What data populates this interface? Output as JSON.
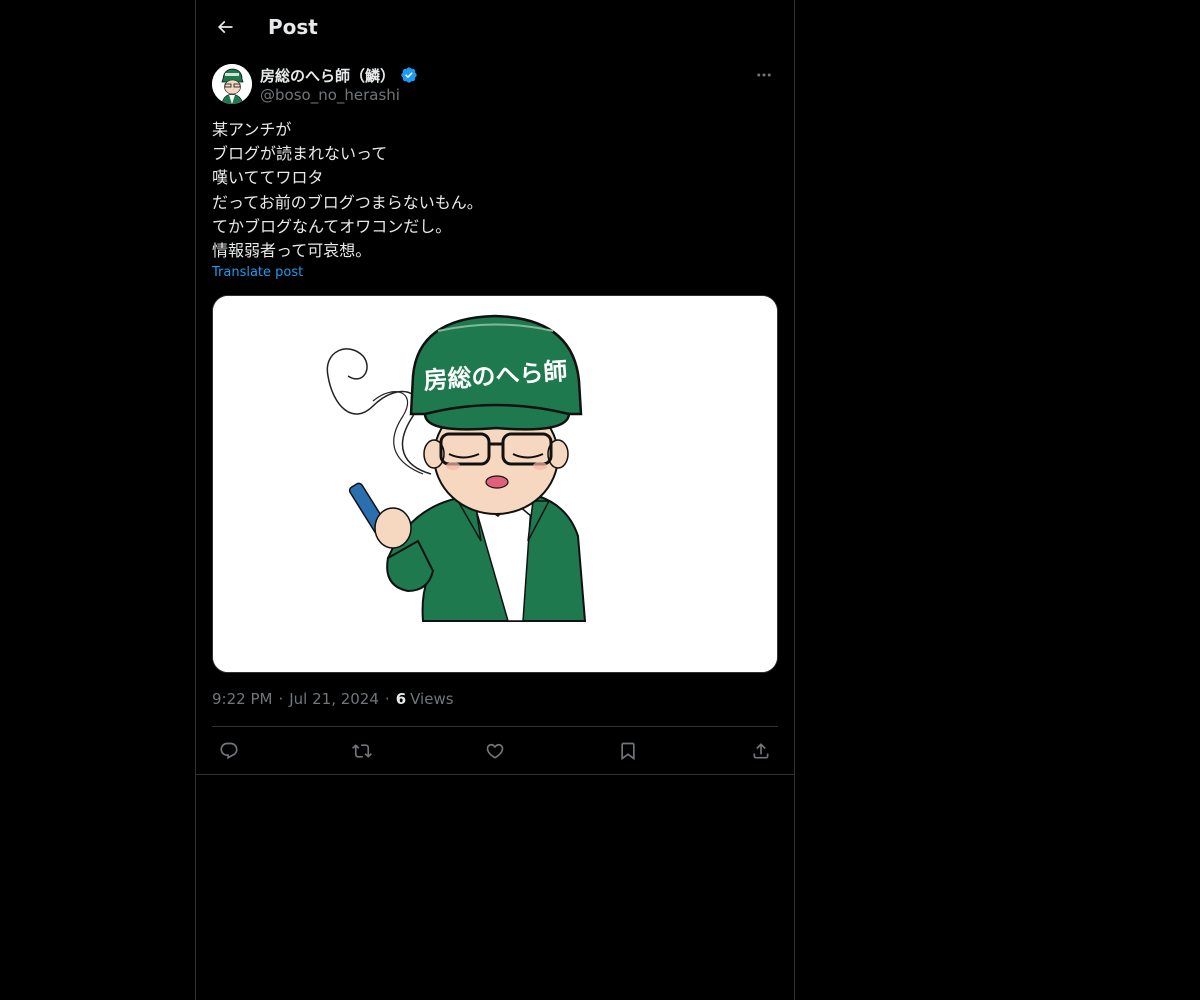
{
  "header": {
    "title": "Post",
    "back_icon": "arrow-left-icon"
  },
  "post": {
    "author": {
      "display_name": "房総のへら師（鱗）",
      "handle": "@boso_no_herashi",
      "verified": true,
      "verified_color": "#1d9bf0"
    },
    "text_lines": [
      "某アンチが",
      "ブログが読まれないって",
      "嘆いててワロタ",
      "だってお前のブログつまらないもん。",
      "てかブログなんてオワコンだし。",
      "情報弱者って可哀想。"
    ],
    "translate_label": "Translate post",
    "image": {
      "cap_text": "房総のへら師",
      "cap_color": "#1e7a4e",
      "jacket_color": "#1e7a4e"
    },
    "time": "9:22 PM",
    "date": "Jul 21, 2024",
    "views_count": "6",
    "views_label": "Views"
  },
  "actions": [
    {
      "name": "reply",
      "icon": "reply-icon"
    },
    {
      "name": "repost",
      "icon": "repost-icon"
    },
    {
      "name": "like",
      "icon": "heart-icon"
    },
    {
      "name": "bookmark",
      "icon": "bookmark-icon"
    },
    {
      "name": "share",
      "icon": "share-icon"
    }
  ],
  "colors": {
    "background": "#000000",
    "text_primary": "#e7e9ea",
    "text_secondary": "#71767b",
    "accent": "#1d9bf0",
    "border": "#2f3336"
  }
}
